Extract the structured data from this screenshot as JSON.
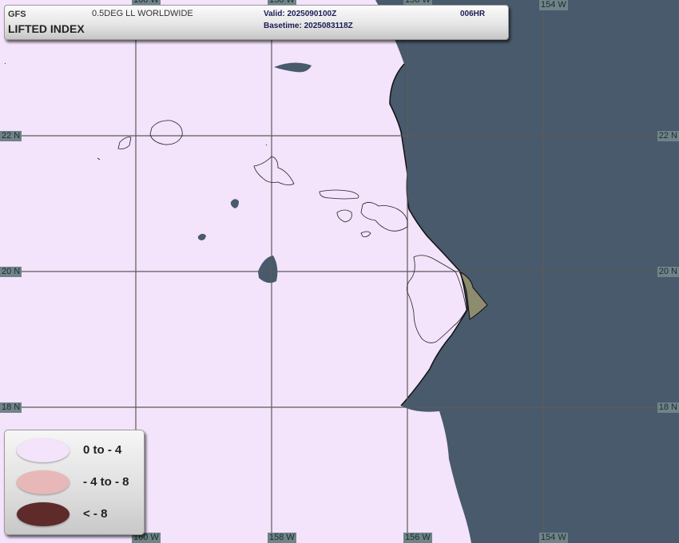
{
  "header": {
    "model": "GFS",
    "grid": "0.5DEG LL WORLDWIDE",
    "valid": "Valid: 2025090100Z",
    "basetime": "Basetime: 2025083118Z",
    "forecast_hour": "006HR",
    "title": "LIFTED INDEX"
  },
  "grid_labels": {
    "lat_22": "22 N",
    "lat_20": "20 N",
    "lat_18": "18 N",
    "lon_160": "160 W",
    "lon_158": "158 W",
    "lon_156": "156 W",
    "lon_154": "154 W"
  },
  "legend": [
    {
      "label": "0 to - 4",
      "color": "#f3e3fb"
    },
    {
      "label": "- 4 to - 8",
      "color": "#e8b8b8"
    },
    {
      "label": "< - 8",
      "color": "#5e2a2a"
    }
  ],
  "colors": {
    "ocean": "#485a6c",
    "band_0_to_-4": "#f3e3fb",
    "band_-4_to_-8": "#e8b8b8",
    "band_lt_-8": "#5e2a2a",
    "positive_area": "#8e8c6e",
    "gridline": "#5b5b5b",
    "coastline": "#222222"
  }
}
